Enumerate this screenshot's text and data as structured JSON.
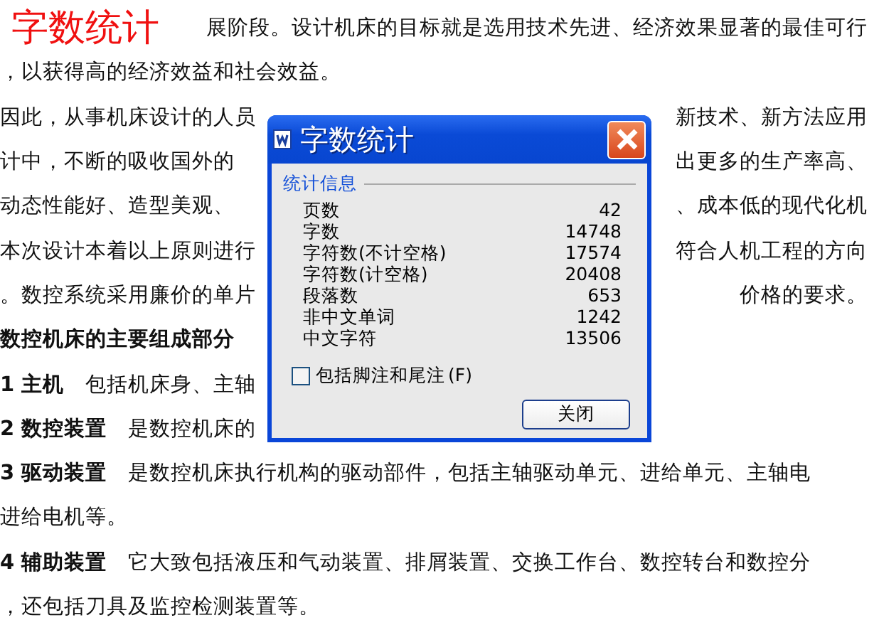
{
  "document": {
    "lines": [
      {
        "kind": "labelled",
        "left": "展阶段。设计机床的目标就是选用技术先进、经济效果显著的最佳可行"
      },
      {
        "kind": "plain",
        "left": "，以获得高的经济效益和社会效益。"
      },
      {
        "kind": "split",
        "left": "因此，从事机床设计的人员",
        "right": "新技术、新方法应用"
      },
      {
        "kind": "split",
        "left": "计中，不断的吸收国外的",
        "right": "出更多的生产率高、"
      },
      {
        "kind": "split",
        "left": "动态性能好、造型美观、",
        "right": "、成本低的现代化机"
      },
      {
        "kind": "split",
        "left": "本次设计本着以上原则进行",
        "right": "符合人机工程的方向"
      },
      {
        "kind": "split",
        "left": "。数控系统采用廉价的单片",
        "right": "价格的要求。"
      },
      {
        "kind": "heading",
        "left": "数控机床的主要组成部分"
      },
      {
        "kind": "plain",
        "left": "**1 主机**　包括机床身、主轴"
      },
      {
        "kind": "plain",
        "left": "**2 数控装置**　是数控机床的"
      },
      {
        "kind": "plain",
        "left": "**3 驱动装置**　是数控机床执行机构的驱动部件，包括主轴驱动单元、进给单元、主轴电"
      },
      {
        "kind": "plain",
        "left": "进给电机等。"
      },
      {
        "kind": "plain",
        "left": "**4 辅助装置**　它大致包括液压和气动装置、排屑装置、交换工作台、数控转台和数控分"
      },
      {
        "kind": "plain",
        "left": "，还包括刀具及监控检测装置等。"
      }
    ]
  },
  "overlay_label": "字数统计",
  "dialog": {
    "title": "字数统计",
    "group": "统计信息",
    "stats": [
      {
        "label": "页数",
        "value": "42"
      },
      {
        "label": "字数",
        "value": "14748"
      },
      {
        "label": "字符数(不计空格)",
        "value": "17574"
      },
      {
        "label": "字符数(计空格)",
        "value": "20408"
      },
      {
        "label": "段落数",
        "value": "653"
      },
      {
        "label": "非中文单词",
        "value": "1242"
      },
      {
        "label": "中文字符",
        "value": "13506"
      }
    ],
    "checkbox": {
      "label": "包括脚注和尾注",
      "hotkey": "(F)",
      "checked": false
    },
    "button": "关闭"
  }
}
